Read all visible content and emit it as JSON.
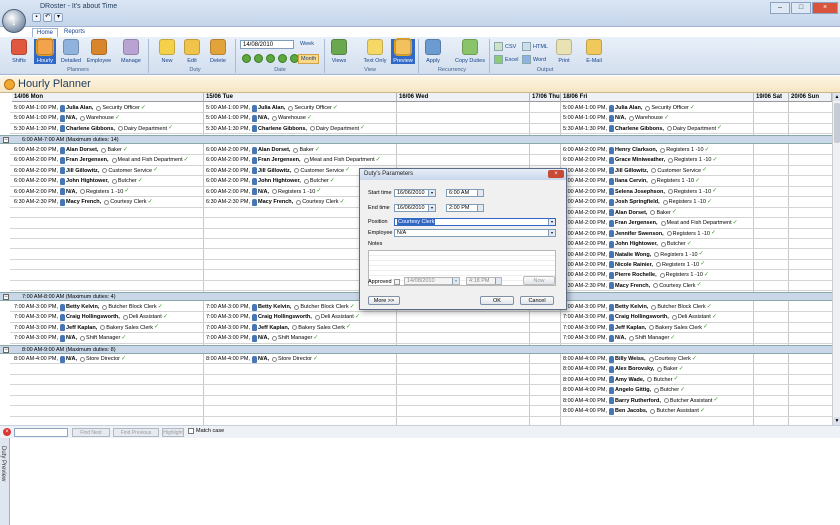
{
  "window": {
    "title": "DRoster - It's about Time"
  },
  "tabs": [
    "Home",
    "Reports"
  ],
  "ribbon": {
    "planner_buttons": [
      "Shifts",
      "Hourly",
      "Detailed",
      "Employee",
      "Manage"
    ],
    "duty_buttons": [
      "New",
      "Edit",
      "Delete"
    ],
    "date_value": "14/08/2010",
    "view_buttons": [
      "Week",
      "Month",
      "Views",
      "Text Only",
      "Preview"
    ],
    "recurrency_buttons": [
      "Apply",
      "Copy Duties"
    ],
    "output_buttons": [
      "CSV",
      "HTML",
      "Excel",
      "Word",
      "Print",
      "E-Mail"
    ],
    "groups": [
      "Planners",
      "Duty",
      "Date",
      "View",
      "Recurrency",
      "Output"
    ]
  },
  "header": {
    "title": "Hourly Planner"
  },
  "days": [
    "14/06 Mon",
    "15/06 Tue",
    "16/06 Wed",
    "17/06 Thu",
    "18/06 Fri",
    "19/06 Sat",
    "20/06 Sun"
  ],
  "groups": [
    {
      "label": "6:00 AM-7:00 AM (Maximum duties: 14)"
    },
    {
      "label": "7:00 AM-8:00 AM (Maximum duties: 4)"
    },
    {
      "label": "8:00 AM-9:00 AM (Maximum duties: 8)"
    }
  ],
  "top_rows": [
    {
      "mon": [
        "5:00 AM-1:00 PM,",
        "Julia Alan,",
        "Security Officer"
      ],
      "tue": [
        "5:00 AM-1:00 PM,",
        "Julia Alan,",
        "Security Officer"
      ],
      "fri": [
        "5:00 AM-1:00 PM,",
        "Julia Alan,",
        "Security Officer"
      ]
    },
    {
      "mon": [
        "5:00 AM-1:00 PM,",
        "N/A,",
        "Warehouse"
      ],
      "tue": [
        "5:00 AM-1:00 PM,",
        "N/A,",
        "Warehouse"
      ],
      "fri": [
        "5:00 AM-1:00 PM,",
        "N/A,",
        "Warehouse"
      ]
    },
    {
      "mon": [
        "5:30 AM-1:30 PM,",
        "Charlene Gibbons,",
        "Dairy Department"
      ],
      "tue": [
        "5:30 AM-1:30 PM,",
        "Charlene Gibbons,",
        "Dairy Department"
      ],
      "fri": [
        "5:30 AM-1:30 PM,",
        "Charlene Gibbons,",
        "Dairy Department"
      ]
    }
  ],
  "g1_rows": [
    {
      "mon": [
        "6:00 AM-2:00 PM,",
        "Alan Dorset,",
        "Baker"
      ],
      "tue": [
        "6:00 AM-2:00 PM,",
        "Alan Dorset,",
        "Baker"
      ],
      "fri": [
        "6:00 AM-2:00 PM,",
        "Henry Clarkson,",
        "Registers 1 -10"
      ]
    },
    {
      "mon": [
        "6:00 AM-2:00 PM,",
        "Fran Jergensen,",
        "Meat and Fish Department"
      ],
      "tue": [
        "6:00 AM-2:00 PM,",
        "Fran Jergensen,",
        "Meat and Fish Department"
      ],
      "fri": [
        "6:00 AM-2:00 PM,",
        "Grace Miniweather,",
        "Registers 1 -10"
      ]
    },
    {
      "mon": [
        "6:00 AM-2:00 PM,",
        "Jill Gillowitz,",
        "Customer Service"
      ],
      "tue": [
        "6:00 AM-2:00 PM,",
        "Jill Gillowitz,",
        "Customer Service"
      ],
      "fri": [
        "6:00 AM-2:00 PM,",
        "Jill Gillowitz,",
        "Customer Service"
      ]
    },
    {
      "mon": [
        "6:00 AM-2:00 PM,",
        "John Hightower,",
        "Butcher"
      ],
      "tue": [
        "6:00 AM-2:00 PM,",
        "John Hightower,",
        "Butcher"
      ],
      "fri": [
        "6:00 AM-2:00 PM,",
        "Ilana Cervin,",
        "Registers 1 -10"
      ]
    },
    {
      "mon": [
        "6:00 AM-2:00 PM,",
        "N/A,",
        "Registers 1 -10"
      ],
      "tue": [
        "6:00 AM-2:00 PM,",
        "N/A,",
        "Registers 1 -10"
      ],
      "fri": [
        "6:00 AM-2:00 PM,",
        "Selena Josephson,",
        "Registers 1 -10"
      ]
    },
    {
      "mon": [
        "6:30 AM-2:30 PM,",
        "Macy French,",
        "Courtesy Clerk"
      ],
      "tue": [
        "6:30 AM-2:30 PM,",
        "Macy French,",
        "Courtesy Clerk"
      ],
      "fri": [
        "6:00 AM-2:00 PM,",
        "Josh Springfield,",
        "Registers 1 -10"
      ]
    },
    {
      "fri": [
        "6:00 AM-2:00 PM,",
        "Alan Dorset,",
        "Baker"
      ]
    },
    {
      "fri": [
        "6:00 AM-2:00 PM,",
        "Fran Jergensen,",
        "Meat and Fish Department"
      ]
    },
    {
      "fri": [
        "6:00 AM-2:00 PM,",
        "Jennifer Swenson,",
        "Registers 1 -10"
      ]
    },
    {
      "fri": [
        "6:00 AM-2:00 PM,",
        "John Hightower,",
        "Butcher"
      ]
    },
    {
      "fri": [
        "6:00 AM-2:00 PM,",
        "Natalie Wong,",
        "Registers 1 -10"
      ]
    },
    {
      "fri": [
        "6:00 AM-2:00 PM,",
        "Nicole Rainier,",
        "Registers 1 -10"
      ]
    },
    {
      "fri": [
        "6:00 AM-2:00 PM,",
        "Pierre Rochelle,",
        "Registers 1 -10"
      ]
    },
    {
      "fri": [
        "6:30 AM-2:30 PM,",
        "Macy French,",
        "Courtesy Clerk"
      ]
    }
  ],
  "g2_rows": [
    {
      "mon": [
        "7:00 AM-3:00 PM,",
        "Betty Kelvin,",
        "Butcher Block Clerk"
      ],
      "tue": [
        "7:00 AM-3:00 PM,",
        "Betty Kelvin,",
        "Butcher Block Clerk"
      ],
      "fri": [
        "7:00 AM-3:00 PM,",
        "Betty Kelvin,",
        "Butcher Block Clerk"
      ]
    },
    {
      "mon": [
        "7:00 AM-3:00 PM,",
        "Craig Hollingsworth,",
        "Deli Assistant"
      ],
      "tue": [
        "7:00 AM-3:00 PM,",
        "Craig Hollingsworth,",
        "Deli Assistant"
      ],
      "fri": [
        "7:00 AM-3:00 PM,",
        "Craig Hollingsworth,",
        "Deli Assistant"
      ]
    },
    {
      "mon": [
        "7:00 AM-3:00 PM,",
        "Jeff Kaplan,",
        "Bakery Sales Clerk"
      ],
      "tue": [
        "7:00 AM-3:00 PM,",
        "Jeff Kaplan,",
        "Bakery Sales Clerk"
      ],
      "fri": [
        "7:00 AM-3:00 PM,",
        "Jeff Kaplan,",
        "Bakery Sales Clerk"
      ]
    },
    {
      "mon": [
        "7:00 AM-3:00 PM,",
        "N/A,",
        "Shift Manager"
      ],
      "tue": [
        "7:00 AM-3:00 PM,",
        "N/A,",
        "Shift Manager"
      ],
      "fri": [
        "7:00 AM-3:00 PM,",
        "N/A,",
        "Shift Manager"
      ]
    }
  ],
  "g3_rows": [
    {
      "mon": [
        "8:00 AM-4:00 PM,",
        "N/A,",
        "Store Director"
      ],
      "tue": [
        "8:00 AM-4:00 PM,",
        "N/A,",
        "Store Director"
      ],
      "fri": [
        "8:00 AM-4:00 PM,",
        "Billy Weiss,",
        "Courtesy Clerk"
      ]
    },
    {
      "fri": [
        "8:00 AM-4:00 PM,",
        "Alex Borovsky,",
        "Baker"
      ]
    },
    {
      "fri": [
        "8:00 AM-4:00 PM,",
        "Amy Wade,",
        "Butcher"
      ]
    },
    {
      "fri": [
        "8:00 AM-4:00 PM,",
        "Angelo Gittig,",
        "Butcher"
      ]
    },
    {
      "fri": [
        "8:00 AM-4:00 PM,",
        "Barry Rutherford,",
        "Butcher Assistant"
      ]
    },
    {
      "fri": [
        "8:00 AM-4:00 PM,",
        "Ben Jacobs,",
        "Butcher Assistant"
      ]
    }
  ],
  "findbar": {
    "buttons": [
      "Find Next",
      "Find Previous",
      "Highlight"
    ],
    "match_case": "Match case"
  },
  "sidebar": {
    "label": "Duty Preview"
  },
  "dialog": {
    "title": "Duty's Parameters",
    "start_label": "Start time",
    "start_date": "16/06/2010",
    "start_time": "6:00 AM",
    "end_label": "End time",
    "end_date": "16/06/2010",
    "end_time": "2:00 PM",
    "position_label": "Position",
    "position_value": "Courtesy Clerk",
    "employee_label": "Employee",
    "employee_value": "N/A",
    "notes_label": "Notes",
    "approved_label": "Approved",
    "approved_date": "14/08/2010",
    "approved_time": "4:18 PM",
    "now_button": "Now",
    "more_button": "More >>",
    "ok_button": "OK",
    "cancel_button": "Cancel"
  }
}
